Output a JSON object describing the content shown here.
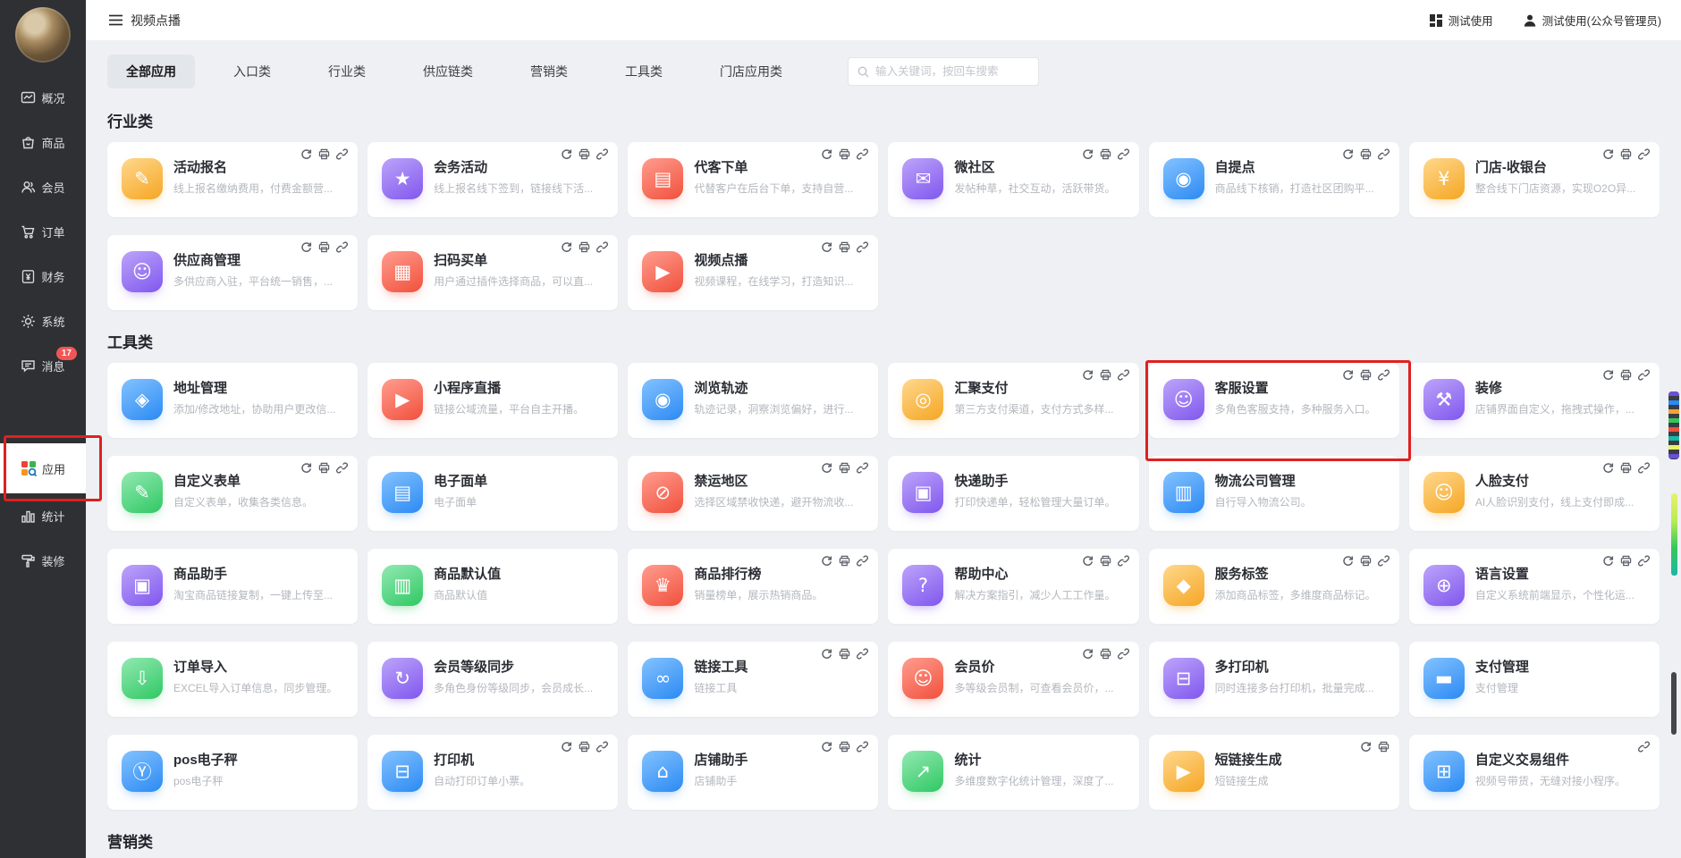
{
  "header": {
    "title": "视频点播",
    "workspace_label": "测试使用",
    "user_label": "测试使用(公众号管理员)"
  },
  "sidebar": {
    "items": [
      {
        "id": "overview",
        "label": "概况",
        "icon": "monitor-icon"
      },
      {
        "id": "goods",
        "label": "商品",
        "icon": "bag-icon"
      },
      {
        "id": "member",
        "label": "会员",
        "icon": "user-icon"
      },
      {
        "id": "order",
        "label": "订单",
        "icon": "cart-icon"
      },
      {
        "id": "finance",
        "label": "财务",
        "icon": "ledger-icon"
      },
      {
        "id": "system",
        "label": "系统",
        "icon": "gear-icon"
      },
      {
        "id": "message",
        "label": "消息",
        "icon": "chat-icon",
        "badge": "17"
      },
      {
        "id": "apps",
        "label": "应用",
        "icon": "apps-grid-icon",
        "active": true
      },
      {
        "id": "stats",
        "label": "统计",
        "icon": "bar-chart-icon"
      },
      {
        "id": "design",
        "label": "装修",
        "icon": "paint-icon"
      }
    ]
  },
  "tabs": {
    "active_index": 0,
    "items": [
      "全部应用",
      "入口类",
      "行业类",
      "供应链类",
      "营销类",
      "工具类",
      "门店应用类"
    ]
  },
  "search": {
    "placeholder": "输入关键词，按回车搜索"
  },
  "sections": [
    {
      "title": "行业类",
      "apps": [
        {
          "name": "活动报名",
          "desc": "线上报名缴纳费用，付费金额营...",
          "color": "orange",
          "glyph": "✎",
          "icon": "form-pencil-icon",
          "actions": [
            "sync",
            "print",
            "link"
          ]
        },
        {
          "name": "会务活动",
          "desc": "线上报名线下签到，链接线下活...",
          "color": "purple",
          "glyph": "★",
          "icon": "bookmark-star-icon",
          "actions": [
            "sync",
            "print",
            "link"
          ]
        },
        {
          "name": "代客下单",
          "desc": "代替客户在后台下单，支持自营...",
          "color": "red",
          "glyph": "▤",
          "icon": "clipboard-icon",
          "actions": [
            "sync",
            "print",
            "link"
          ]
        },
        {
          "name": "微社区",
          "desc": "发帖种草，社交互动，活跃带货。",
          "color": "purple",
          "glyph": "✉",
          "icon": "chat-bubble-icon",
          "actions": [
            "sync",
            "print",
            "link"
          ]
        },
        {
          "name": "自提点",
          "desc": "商品线下核销，打造社区团购平...",
          "color": "blue",
          "glyph": "◉",
          "icon": "pickup-pin-icon",
          "actions": [
            "sync",
            "print",
            "link"
          ]
        },
        {
          "name": "门店-收银台",
          "desc": "整合线下门店资源，实现O2O异...",
          "color": "orange",
          "glyph": "¥",
          "icon": "cashier-icon",
          "actions": [
            "sync",
            "print",
            "link"
          ]
        },
        {
          "name": "供应商管理",
          "desc": "多供应商入驻，平台统一销售，...",
          "color": "purple",
          "glyph": "☺",
          "icon": "supplier-person-icon",
          "actions": [
            "sync",
            "print",
            "link"
          ]
        },
        {
          "name": "扫码买单",
          "desc": "用户通过插件选择商品，可以直...",
          "color": "red",
          "glyph": "▦",
          "icon": "scan-pay-icon",
          "actions": [
            "sync",
            "print",
            "link"
          ]
        },
        {
          "name": "视频点播",
          "desc": "视频课程，在线学习，打造知识...",
          "color": "red",
          "glyph": "▶",
          "icon": "video-icon",
          "actions": [
            "sync",
            "print",
            "link"
          ]
        }
      ]
    },
    {
      "title": "工具类",
      "apps": [
        {
          "name": "地址管理",
          "desc": "添加/修改地址，协助用户更改信...",
          "color": "blue",
          "glyph": "◈",
          "icon": "address-icon",
          "actions": []
        },
        {
          "name": "小程序直播",
          "desc": "链接公域流量，平台自主开播。",
          "color": "red",
          "glyph": "▶",
          "icon": "live-camera-icon",
          "actions": []
        },
        {
          "name": "浏览轨迹",
          "desc": "轨迹记录，洞察浏览偏好，进行...",
          "color": "blue",
          "glyph": "◉",
          "icon": "track-pin-icon",
          "actions": []
        },
        {
          "name": "汇聚支付",
          "desc": "第三方支付渠道，支付方式多样...",
          "color": "orange",
          "glyph": "◎",
          "icon": "coin-icon",
          "actions": [
            "sync",
            "print",
            "link"
          ]
        },
        {
          "name": "客服设置",
          "desc": "多角色客服支持，多种服务入口。",
          "color": "purple",
          "glyph": "☺",
          "icon": "headset-agent-icon",
          "actions": [
            "sync",
            "print",
            "link"
          ],
          "highlight": true
        },
        {
          "name": "装修",
          "desc": "店铺界面自定义，拖拽式操作，...",
          "color": "purple",
          "glyph": "⚒",
          "icon": "paint-roller-icon",
          "actions": [
            "sync",
            "print",
            "link"
          ]
        },
        {
          "name": "自定义表单",
          "desc": "自定义表单，收集各类信息。",
          "color": "green",
          "glyph": "✎",
          "icon": "diy-form-icon",
          "actions": [
            "sync",
            "print",
            "link"
          ]
        },
        {
          "name": "电子面单",
          "desc": "电子面单",
          "color": "blue",
          "glyph": "▤",
          "icon": "waybill-icon",
          "actions": []
        },
        {
          "name": "禁运地区",
          "desc": "选择区域禁收快递，避开物流收...",
          "color": "red",
          "glyph": "⊘",
          "icon": "no-ship-truck-icon",
          "actions": [
            "sync",
            "print",
            "link"
          ]
        },
        {
          "name": "快递助手",
          "desc": "打印快递单，轻松管理大量订单。",
          "color": "purple",
          "glyph": "▣",
          "icon": "express-icon",
          "actions": []
        },
        {
          "name": "物流公司管理",
          "desc": "自行导入物流公司。",
          "color": "blue",
          "glyph": "▥",
          "icon": "logistics-icon",
          "actions": []
        },
        {
          "name": "人脸支付",
          "desc": "AI人脸识别支付，线上支付即成...",
          "color": "orange",
          "glyph": "☺",
          "icon": "face-pay-icon",
          "actions": [
            "sync",
            "print",
            "link"
          ]
        },
        {
          "name": "商品助手",
          "desc": "淘宝商品链接复制，一键上传至...",
          "color": "purple",
          "glyph": "▣",
          "icon": "briefcase-icon",
          "actions": []
        },
        {
          "name": "商品默认值",
          "desc": "商品默认值",
          "color": "green",
          "glyph": "▥",
          "icon": "goods-bag-icon",
          "actions": []
        },
        {
          "name": "商品排行榜",
          "desc": "销量榜单，展示热销商品。",
          "color": "red",
          "glyph": "♛",
          "icon": "trophy-icon",
          "actions": [
            "sync",
            "print",
            "link"
          ]
        },
        {
          "name": "帮助中心",
          "desc": "解决方案指引，减少人工工作量。",
          "color": "purple",
          "glyph": "?",
          "icon": "question-icon",
          "actions": [
            "sync",
            "print",
            "link"
          ]
        },
        {
          "name": "服务标签",
          "desc": "添加商品标签，多维度商品标记。",
          "color": "orange",
          "glyph": "◆",
          "icon": "tag-icon",
          "actions": [
            "sync",
            "print",
            "link"
          ]
        },
        {
          "name": "语言设置",
          "desc": "自定义系统前端显示，个性化运...",
          "color": "purple",
          "glyph": "⊕",
          "icon": "globe-icon",
          "actions": [
            "sync",
            "print",
            "link"
          ]
        },
        {
          "name": "订单导入",
          "desc": "EXCEL导入订单信息，同步管理。",
          "color": "green",
          "glyph": "⇩",
          "icon": "excel-import-icon",
          "actions": []
        },
        {
          "name": "会员等级同步",
          "desc": "多角色身份等级同步，会员成长...",
          "color": "purple",
          "glyph": "↻",
          "icon": "level-sync-icon",
          "actions": []
        },
        {
          "name": "链接工具",
          "desc": "链接工具",
          "color": "blue",
          "glyph": "∞",
          "icon": "link-tool-icon",
          "actions": [
            "sync",
            "print",
            "link"
          ]
        },
        {
          "name": "会员价",
          "desc": "多等级会员制，可查看会员价，...",
          "color": "red",
          "glyph": "☺",
          "icon": "member-price-icon",
          "actions": [
            "sync",
            "print",
            "link"
          ]
        },
        {
          "name": "多打印机",
          "desc": "同时连接多台打印机，批量完成...",
          "color": "purple",
          "glyph": "⊟",
          "icon": "multi-printer-icon",
          "actions": []
        },
        {
          "name": "支付管理",
          "desc": "支付管理",
          "color": "blue",
          "glyph": "▬",
          "icon": "pay-card-icon",
          "actions": []
        },
        {
          "name": "pos电子秤",
          "desc": "pos电子秤",
          "color": "blue",
          "glyph": "Ⓨ",
          "icon": "pos-scale-icon",
          "actions": []
        },
        {
          "name": "打印机",
          "desc": "自动打印订单小票。",
          "color": "blue",
          "glyph": "⊟",
          "icon": "printer-icon",
          "actions": [
            "sync",
            "print",
            "link"
          ]
        },
        {
          "name": "店铺助手",
          "desc": "店铺助手",
          "color": "blue",
          "glyph": "⌂",
          "icon": "shop-helper-icon",
          "actions": [
            "sync",
            "print",
            "link"
          ]
        },
        {
          "name": "统计",
          "desc": "多维度数字化统计管理，深度了...",
          "color": "green",
          "glyph": "↗",
          "icon": "stats-chart-icon",
          "actions": []
        },
        {
          "name": "短链接生成",
          "desc": "短链接生成",
          "color": "orange",
          "glyph": "▶",
          "icon": "short-link-icon",
          "actions": [
            "sync",
            "print"
          ]
        },
        {
          "name": "自定义交易组件",
          "desc": "视频号带货，无缝对接小程序。",
          "color": "blue",
          "glyph": "⊞",
          "icon": "trade-component-icon",
          "actions": [
            "link"
          ]
        }
      ]
    },
    {
      "title": "营销类",
      "apps": []
    }
  ],
  "card_action_icons": {
    "sync": "refresh-icon",
    "print": "printer-icon",
    "link": "link-icon"
  },
  "colors": {
    "sidebar_bg": "#2e3033",
    "badge_red": "#f25555",
    "annotation_red": "#e02020",
    "tile_orange": "#f5a623",
    "tile_red": "#f1503c",
    "tile_purple": "#8057ee",
    "tile_blue": "#2b8af3",
    "tile_green": "#2fc863",
    "active_tab_bg": "#e3e6eb"
  }
}
